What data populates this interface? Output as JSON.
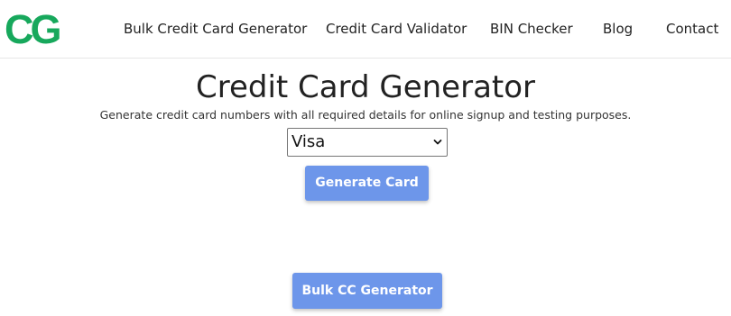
{
  "header": {
    "logo_text": "CG",
    "nav": [
      {
        "label": "Bulk Credit Card Generator"
      },
      {
        "label": "Credit Card Validator"
      },
      {
        "label": "BIN Checker"
      },
      {
        "label": "Blog"
      },
      {
        "label": "Contact"
      }
    ]
  },
  "main": {
    "title": "Credit Card Generator",
    "subtitle": "Generate credit card numbers with all required details for online signup and testing purposes.",
    "card_type": {
      "selected": "Visa"
    },
    "generate_label": "Generate Card",
    "bulk_label": "Bulk CC Generator"
  },
  "colors": {
    "logo_green": "#17a85c",
    "button_blue": "#6d96ea",
    "text": "#222222"
  },
  "icons": {
    "select_chevron": "chevron-down-icon"
  }
}
